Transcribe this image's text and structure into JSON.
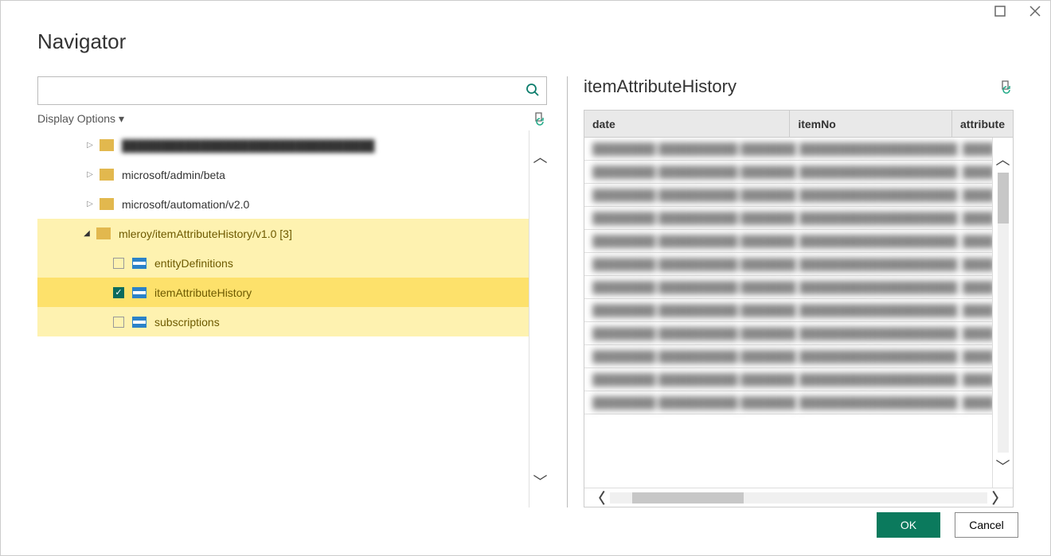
{
  "window": {
    "title": "Navigator"
  },
  "search": {
    "value": "",
    "placeholder": ""
  },
  "display_options_label": "Display Options",
  "tree": {
    "folders": [
      {
        "label": "████████████████████████████████",
        "blur": true,
        "expandable": true
      },
      {
        "label": "microsoft/admin/beta",
        "blur": false,
        "expandable": true
      },
      {
        "label": "microsoft/automation/v2.0",
        "blur": false,
        "expandable": true
      }
    ],
    "open_folder": {
      "label": "mleroy/itemAttributeHistory/v1.0 [3]",
      "children": [
        {
          "label": "entityDefinitions",
          "checked": false
        },
        {
          "label": "itemAttributeHistory",
          "checked": true
        },
        {
          "label": "subscriptions",
          "checked": false
        }
      ]
    }
  },
  "preview": {
    "title": "itemAttributeHistory",
    "columns": {
      "date": "date",
      "itemNo": "itemNo",
      "attribute": "attribute"
    },
    "row_count": 12
  },
  "buttons": {
    "ok": "OK",
    "cancel": "Cancel"
  }
}
